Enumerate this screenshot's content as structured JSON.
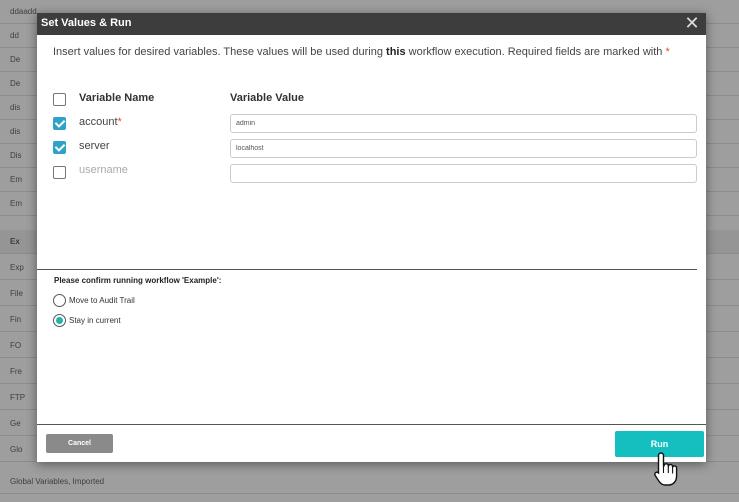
{
  "background_list": {
    "rows": [
      {
        "label": "ddaadd"
      },
      {
        "label": "dd"
      },
      {
        "label": "De"
      },
      {
        "label": "De"
      },
      {
        "label": "dis"
      },
      {
        "label": "dis"
      },
      {
        "label": "Dis"
      },
      {
        "label": "Em"
      },
      {
        "label": "Em"
      },
      {
        "label": "Ex"
      },
      {
        "label": "Exp"
      },
      {
        "label": "File"
      },
      {
        "label": "Fin"
      },
      {
        "label": "FO"
      },
      {
        "label": "Fre"
      },
      {
        "label": "FTP"
      },
      {
        "label": "Ge"
      },
      {
        "label": "Glo"
      },
      {
        "label": "Global Variables, Imported"
      }
    ]
  },
  "modal": {
    "title": "Set Values & Run",
    "close_symbol": "✕",
    "intro_part1": "Insert values for desired variables. These values will be used during ",
    "intro_bold": "this",
    "intro_part2": " workflow execution. Required fields are marked with ",
    "required_mark": "*",
    "columns": {
      "name": "Variable Name",
      "value": "Variable Value"
    },
    "variables": [
      {
        "name": "account",
        "required": "*",
        "checked": true,
        "value": "admin"
      },
      {
        "name": "server",
        "required": "",
        "checked": true,
        "value": "localhost"
      },
      {
        "name": "username",
        "required": "",
        "checked": false,
        "value": ""
      }
    ],
    "confirm_label": "Please confirm running workflow 'Example':",
    "options": [
      {
        "label": "Move to Audit Trail",
        "selected": false
      },
      {
        "label": "Stay in current",
        "selected": true
      }
    ],
    "cancel_label": "Cancel",
    "run_label": "Run"
  },
  "colors": {
    "accent": "#15bfbf",
    "header": "#3d3d3d",
    "checkbox_checked": "#2ea3c7",
    "required": "#e04a3a"
  }
}
